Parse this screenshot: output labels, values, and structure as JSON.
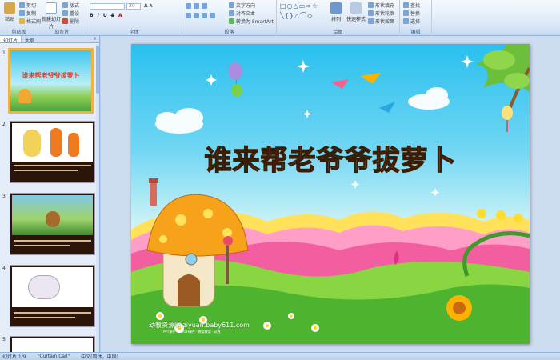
{
  "ribbon": {
    "clipboard": {
      "label": "剪贴板",
      "paste": "粘贴",
      "cut": "剪切",
      "copy": "复制",
      "format_painter": "格式刷"
    },
    "slides": {
      "label": "幻灯片",
      "new_slide": "新建幻灯片",
      "layout": "版式",
      "reset": "重设",
      "delete": "删除"
    },
    "font": {
      "label": "字体",
      "font_size": "20"
    },
    "paragraph": {
      "label": "段落",
      "text_direction": "文字方向",
      "align_text": "对齐文本",
      "smartart": "转换为 SmartArt"
    },
    "drawing": {
      "label": "绘图",
      "arrange": "排列",
      "quick_styles": "快速样式",
      "shape_fill": "形状填充",
      "shape_outline": "形状轮廓",
      "shape_effects": "形状效果"
    },
    "editing": {
      "label": "编辑",
      "find": "查找",
      "replace": "替换",
      "select": "选择"
    }
  },
  "sidebar": {
    "tabs": [
      "幻灯片",
      "大纲"
    ],
    "close": "×",
    "thumbs": [
      {
        "num": "1",
        "caption": "谁来帮老爷爷拔萝卜"
      },
      {
        "num": "2",
        "caption": ""
      },
      {
        "num": "3",
        "caption": ""
      },
      {
        "num": "4",
        "caption": ""
      },
      {
        "num": "5",
        "caption": ""
      }
    ]
  },
  "slide": {
    "title_chars": [
      {
        "ch": "谁",
        "color": "#ff7a10"
      },
      {
        "ch": "来",
        "color": "#e8352a"
      },
      {
        "ch": "帮",
        "color": "#d62a84"
      },
      {
        "ch": "老",
        "color": "#8b3fd0"
      },
      {
        "ch": "爷",
        "color": "#2f86e8"
      },
      {
        "ch": "爷",
        "color": "#2fbd3a"
      },
      {
        "ch": "拔",
        "color": "#e6b420"
      },
      {
        "ch": "萝",
        "color": "#ff7a10"
      },
      {
        "ch": "卜",
        "color": "#e8352a"
      }
    ],
    "footer": "幼教资源网 ziyuan.baby611.com",
    "footer_sub": "PPT课件 · FLASH课件 · 教案教案 · 试卷"
  },
  "status": {
    "slide_count": "幻灯片 1/9",
    "theme": "\"Curtain Call\"",
    "language": "中文(简体，中国)"
  }
}
